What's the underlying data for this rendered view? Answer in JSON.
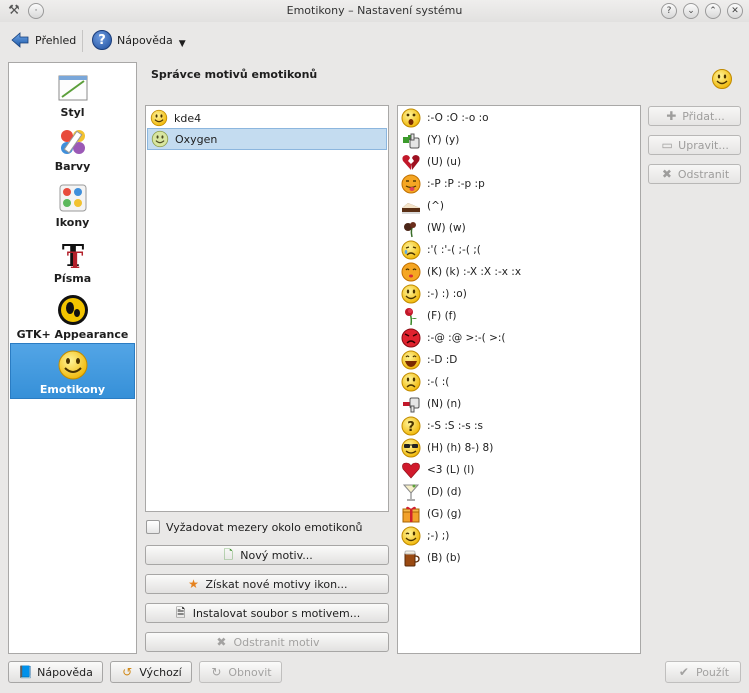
{
  "window": {
    "title": "Emotikony – Nastavení systému",
    "help_btn": "?",
    "min_btn": "⌄",
    "max_btn": "⌃",
    "close_btn": "✕"
  },
  "toolbar": {
    "overview_label": "Přehled",
    "help_label": "Nápověda"
  },
  "sidebar": {
    "items": [
      {
        "label": "Styl",
        "icon": "style-icon"
      },
      {
        "label": "Barvy",
        "icon": "colors-icon"
      },
      {
        "label": "Ikony",
        "icon": "icons-icon"
      },
      {
        "label": "Písma",
        "icon": "fonts-icon"
      },
      {
        "label": "GTK+ Appearance",
        "icon": "gtk-icon"
      },
      {
        "label": "Emotikony",
        "icon": "emoticons-icon",
        "selected": true
      }
    ]
  },
  "main": {
    "title": "Správce motivů emotikonů",
    "themes": [
      {
        "label": "kde4",
        "selected": false
      },
      {
        "label": "Oxygen",
        "selected": true
      }
    ],
    "require_spaces_label": "Vyžadovat mezery okolo emotikonů",
    "new_theme_label": "Nový motiv...",
    "get_new_label": "Získat nové motivy ikon...",
    "install_label": "Instalovat soubor s motivem...",
    "remove_theme_label": "Odstranit motiv"
  },
  "emoticons": [
    {
      "text": ":-O :O :-o :o",
      "icon": "surprised-icon"
    },
    {
      "text": "(Y) (y)",
      "icon": "thumbs-up-icon"
    },
    {
      "text": "(U) (u)",
      "icon": "broken-heart-icon"
    },
    {
      "text": ":-P :P :-p :p",
      "icon": "tongue-icon"
    },
    {
      "text": "(^)",
      "icon": "cake-icon"
    },
    {
      "text": "(W) (w)",
      "icon": "wilted-rose-icon"
    },
    {
      "text": ":'( :'-( ;-( ;(",
      "icon": "crying-icon"
    },
    {
      "text": "(K) (k) :-X :X :-x :x",
      "icon": "kiss-icon"
    },
    {
      "text": ":-) :) :o)",
      "icon": "smile-icon"
    },
    {
      "text": "(F) (f)",
      "icon": "rose-icon"
    },
    {
      "text": ":-@ :@ >:-( >:(",
      "icon": "angry-icon"
    },
    {
      "text": ":-D :D",
      "icon": "laugh-icon"
    },
    {
      "text": ":-( :(",
      "icon": "sad-icon"
    },
    {
      "text": "(N) (n)",
      "icon": "thumbs-down-icon"
    },
    {
      "text": ":-S :S :-s :s",
      "icon": "confused-icon"
    },
    {
      "text": "(H) (h) 8-) 8)",
      "icon": "cool-icon"
    },
    {
      "text": "<3 (L) (l)",
      "icon": "heart-icon"
    },
    {
      "text": "(D) (d)",
      "icon": "cocktail-icon"
    },
    {
      "text": "(G) (g)",
      "icon": "gift-icon"
    },
    {
      "text": ";-) ;)",
      "icon": "wink-icon"
    },
    {
      "text": "(B) (b)",
      "icon": "beer-icon"
    }
  ],
  "actions": {
    "add_label": "Přidat...",
    "edit_label": "Upravit...",
    "remove_label": "Odstranit"
  },
  "footer": {
    "help_label": "Nápověda",
    "defaults_label": "Výchozí",
    "reset_label": "Obnovit",
    "apply_label": "Použít"
  },
  "colors": {
    "selection": "#3690d8",
    "list_selection": "#c4dcf0"
  }
}
